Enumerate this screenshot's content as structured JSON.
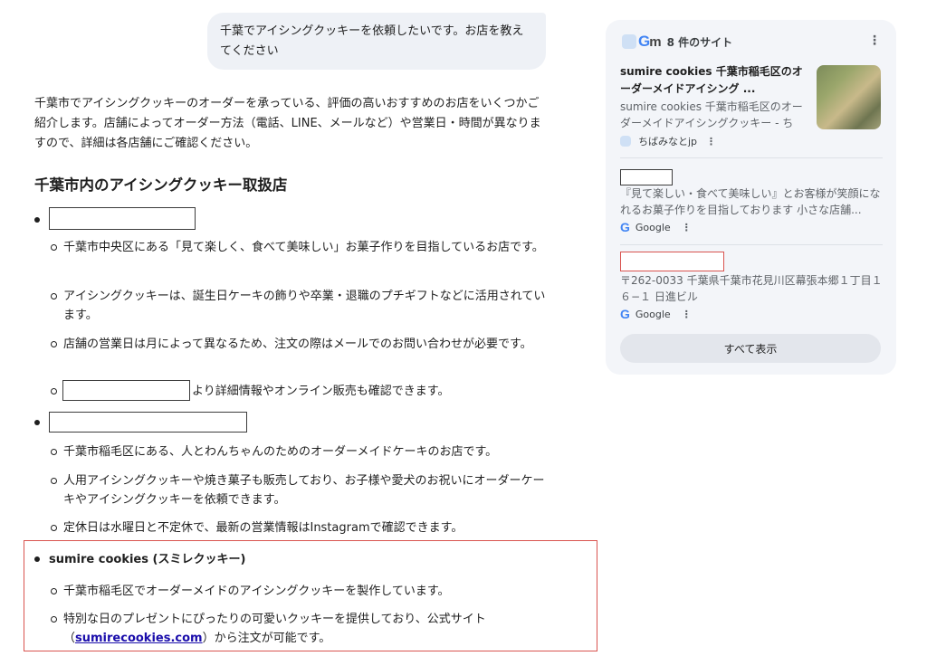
{
  "user_message": "千葉でアイシングクッキーを依頼したいです。お店を教えてください",
  "answer": {
    "intro": "千葉市でアイシングクッキーのオーダーを承っている、評価の高いおすすめのお店をいくつかご紹介します。店舗によってオーダー方法（電話、LINE、メールなど）や営業日・時間が異なりますので、詳細は各店舗にご確認ください。",
    "heading": "千葉市内のアイシングクッキー取扱店",
    "shop1": {
      "details": [
        "千葉市中央区にある「見て楽しく、食べて美味しい」お菓子作りを目指しているお店です。",
        "アイシングクッキーは、誕生日ケーキの飾りや卒業・退職のプチギフトなどに活用されています。",
        "店舗の営業日は月によって異なるため、注文の際はメールでのお問い合わせが必要です。"
      ],
      "link_suffix": "より詳細情報やオンライン販売も確認できます。"
    },
    "shop2": {
      "details": [
        "千葉市稲毛区にある、人とわんちゃんのためのオーダーメイドケーキのお店です。",
        "人用アイシングクッキーや焼き菓子も販売しており、お子様や愛犬のお祝いにオーダーケーキやアイシングクッキーを依頼できます。",
        "定休日は水曜日と不定休で、最新の営業情報はInstagramで確認できます。"
      ]
    },
    "shop3": {
      "name": "sumire cookies (スミレクッキー)",
      "detail1": "千葉市稲毛区でオーダーメイドのアイシングクッキーを製作しています。",
      "detail2_before": "特別な日のプレゼントにぴったりの可愛いクッキーを提供しており、公式サイト（",
      "detail2_link": "sumirecookies.com",
      "detail2_after": "）から注文が可能です。"
    }
  },
  "sources": {
    "count_label": "8 件のサイト",
    "items": [
      {
        "title": "sumire cookies 千葉市稲毛区のオーダーメイドアイシング ...",
        "desc": "sumire cookies 千葉市稲毛区のオーダーメイドアイシングクッキー - ちば...",
        "site": "ちばみなとjp"
      },
      {
        "title": "",
        "desc": "『見て楽しい・食べて美味しい』とお客様が笑顔になれるお菓子作りを目指しております 小さな店舗...",
        "site": "Google"
      },
      {
        "title": "",
        "desc": "〒262-0033 千葉県千葉市花見川区幕張本郷１丁目１６−１ 日進ビル",
        "site": "Google"
      }
    ],
    "show_all": "すべて表示"
  },
  "icons": {
    "kebab": "more-vert-icon",
    "google": "google-logo-icon"
  },
  "colors": {
    "highlight_border": "#d9534f",
    "panel_bg": "#f3f5f9",
    "link": "#1a0dab"
  }
}
